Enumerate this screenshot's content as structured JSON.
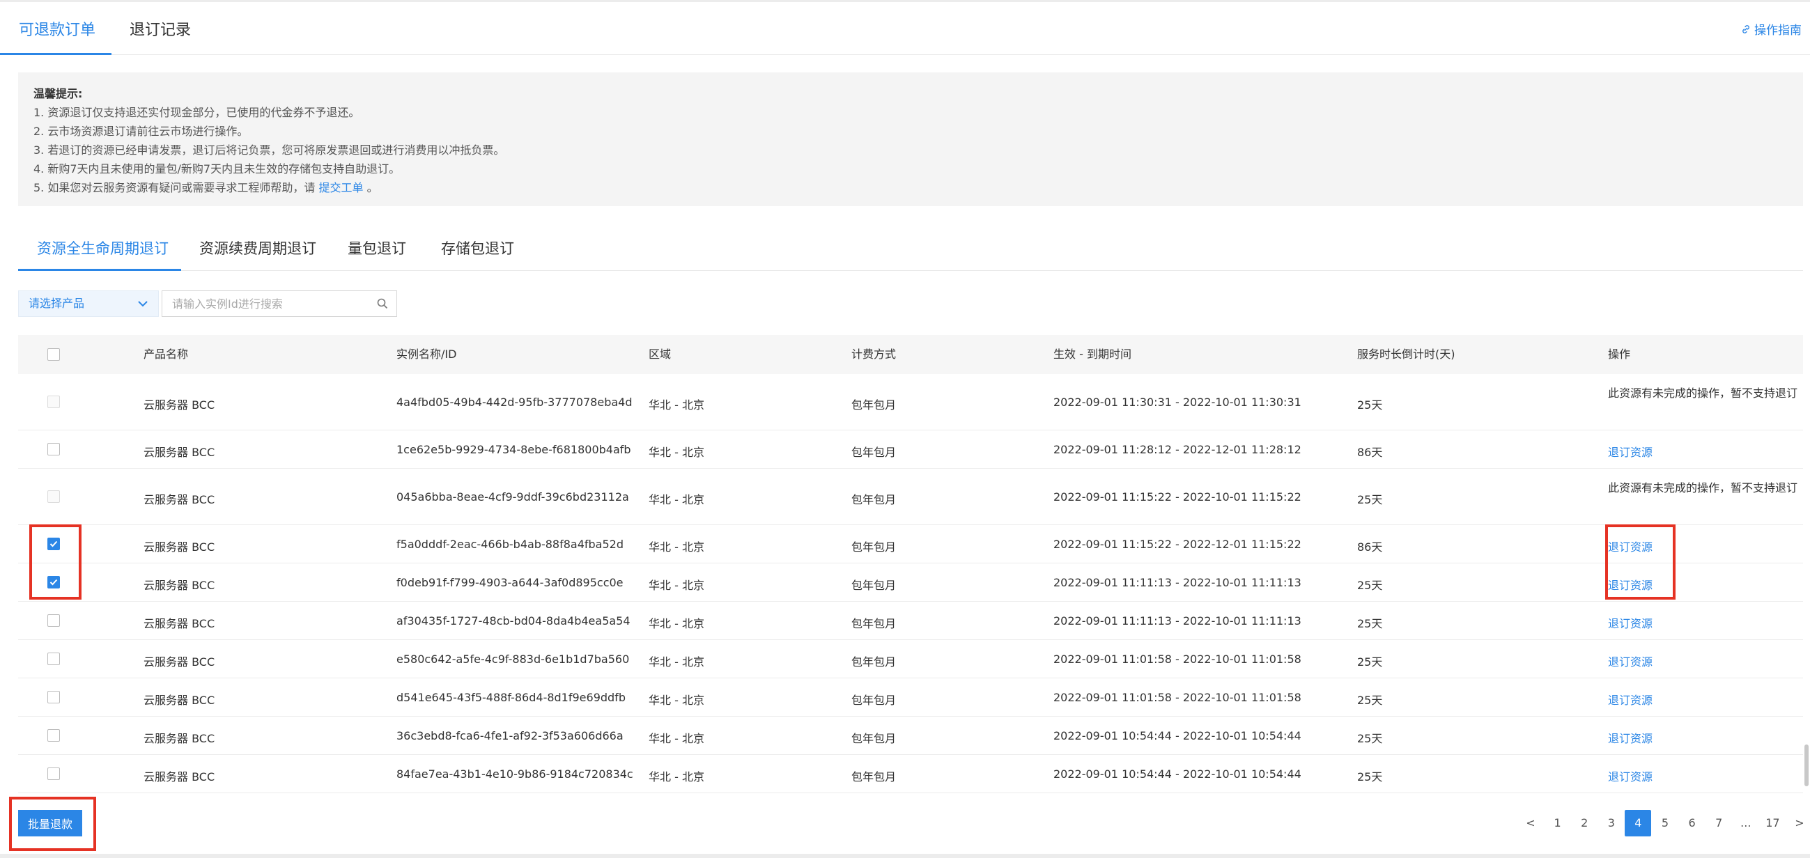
{
  "top_tabs": {
    "refundable": "可退款订单",
    "records": "退订记录"
  },
  "guide_link": "操作指南",
  "notice": {
    "title": "温馨提示:",
    "lines": [
      "1. 资源退订仅支持退还实付现金部分，已使用的代金券不予退还。",
      "2. 云市场资源退订请前往云市场进行操作。",
      "3. 若退订的资源已经申请发票，退订后将记负票，您可将原发票退回或进行消费用以冲抵负票。",
      "4. 新购7天内且未使用的量包/新购7天内且未生效的存储包支持自助退订。"
    ],
    "line5_prefix": "5. 如果您对云服务资源有疑问或需要寻求工程师帮助，请",
    "line5_link": "提交工单",
    "line5_suffix": "。"
  },
  "sub_tabs": {
    "lifecycle": "资源全生命周期退订",
    "renewal": "资源续费周期退订",
    "volume": "量包退订",
    "storage": "存储包退订"
  },
  "filters": {
    "product_select": "请选择产品",
    "search_placeholder": "请输入实例Id进行搜索"
  },
  "table": {
    "headers": {
      "product": "产品名称",
      "instance": "实例名称/ID",
      "region": "区域",
      "billing": "计费方式",
      "period": "生效 - 到期时间",
      "countdown": "服务时长倒计时(天)",
      "action": "操作"
    },
    "rows": [
      {
        "product": "云服务器 BCC",
        "instance": "4a4fbd05-49b4-442d-95fb-3777078eba4d",
        "region": "华北 - 北京",
        "billing": "包年包月",
        "period": "2022-09-01 11:30:31 - 2022-10-01 11:30:31",
        "countdown": "25天",
        "action": "此资源有未完成的操作，暂不支持退订"
      },
      {
        "product": "云服务器 BCC",
        "instance": "1ce62e5b-9929-4734-8ebe-f681800b4afb",
        "region": "华北 - 北京",
        "billing": "包年包月",
        "period": "2022-09-01 11:28:12 - 2022-12-01 11:28:12",
        "countdown": "86天",
        "action": "退订资源"
      },
      {
        "product": "云服务器 BCC",
        "instance": "045a6bba-8eae-4cf9-9ddf-39c6bd23112a",
        "region": "华北 - 北京",
        "billing": "包年包月",
        "period": "2022-09-01 11:15:22 - 2022-10-01 11:15:22",
        "countdown": "25天",
        "action": "此资源有未完成的操作，暂不支持退订"
      },
      {
        "product": "云服务器 BCC",
        "instance": "f5a0dddf-2eac-466b-b4ab-88f8a4fba52d",
        "region": "华北 - 北京",
        "billing": "包年包月",
        "period": "2022-09-01 11:15:22 - 2022-12-01 11:15:22",
        "countdown": "86天",
        "action": "退订资源"
      },
      {
        "product": "云服务器 BCC",
        "instance": "f0deb91f-f799-4903-a644-3af0d895cc0e",
        "region": "华北 - 北京",
        "billing": "包年包月",
        "period": "2022-09-01 11:11:13 - 2022-10-01 11:11:13",
        "countdown": "25天",
        "action": "退订资源"
      },
      {
        "product": "云服务器 BCC",
        "instance": "af30435f-1727-48cb-bd04-8da4b4ea5a54",
        "region": "华北 - 北京",
        "billing": "包年包月",
        "period": "2022-09-01 11:11:13 - 2022-10-01 11:11:13",
        "countdown": "25天",
        "action": "退订资源"
      },
      {
        "product": "云服务器 BCC",
        "instance": "e580c642-a5fe-4c9f-883d-6e1b1d7ba560",
        "region": "华北 - 北京",
        "billing": "包年包月",
        "period": "2022-09-01 11:01:58 - 2022-10-01 11:01:58",
        "countdown": "25天",
        "action": "退订资源"
      },
      {
        "product": "云服务器 BCC",
        "instance": "d541e645-43f5-488f-86d4-8d1f9e69ddfb",
        "region": "华北 - 北京",
        "billing": "包年包月",
        "period": "2022-09-01 11:01:58 - 2022-10-01 11:01:58",
        "countdown": "25天",
        "action": "退订资源"
      },
      {
        "product": "云服务器 BCC",
        "instance": "36c3ebd8-fca6-4fe1-af92-3f53a606d66a",
        "region": "华北 - 北京",
        "billing": "包年包月",
        "period": "2022-09-01 10:54:44 - 2022-10-01 10:54:44",
        "countdown": "25天",
        "action": "退订资源"
      },
      {
        "product": "云服务器 BCC",
        "instance": "84fae7ea-43b1-4e10-9b86-9184c720834c",
        "region": "华北 - 北京",
        "billing": "包年包月",
        "period": "2022-09-01 10:54:44 - 2022-10-01 10:54:44",
        "countdown": "25天",
        "action": "退订资源"
      }
    ]
  },
  "batch_refund": "批量退款",
  "pagination": {
    "prev": "<",
    "pages": [
      "1",
      "2",
      "3",
      "4",
      "5",
      "6",
      "7",
      "...",
      "17"
    ],
    "current": "4",
    "next": ">"
  },
  "colors": {
    "accent": "#2b86e6",
    "annotation": "#e53224"
  }
}
